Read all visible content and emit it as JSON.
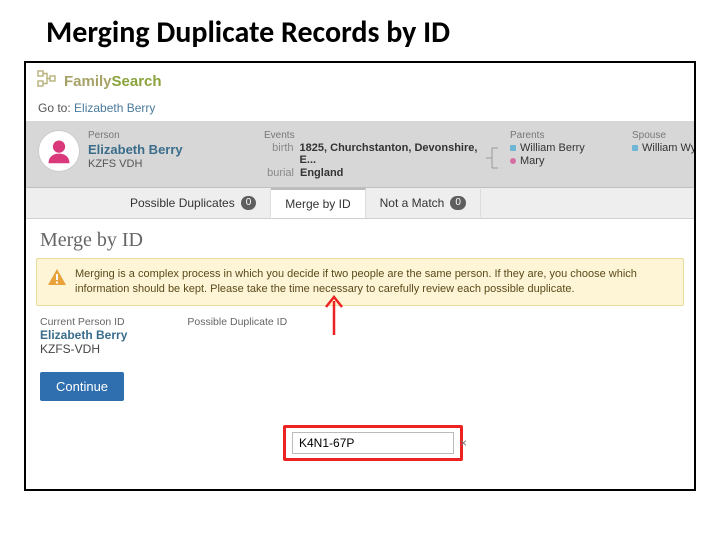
{
  "slide": {
    "title": "Merging Duplicate Records by ID"
  },
  "brand": {
    "part1": "Family",
    "part2": "Search"
  },
  "goto": {
    "label": "Go to: ",
    "link": "Elizabeth Berry"
  },
  "summary": {
    "person_label": "Person",
    "person_name": "Elizabeth Berry",
    "person_id": "KZFS VDH",
    "events_label": "Events",
    "events": [
      {
        "key": "birth",
        "value": "1825, Churchstanton, Devonshire, E..."
      },
      {
        "key": "burial",
        "value": "England"
      }
    ],
    "parents_label": "Parents",
    "parents": [
      {
        "bullet": "b-blue",
        "name": "William Berry"
      },
      {
        "bullet": "b-pink",
        "name": "Mary"
      }
    ],
    "spouse_label": "Spouse",
    "spouse": [
      {
        "bullet": "b-blue",
        "name": "William Wyatt"
      }
    ]
  },
  "tabs": {
    "dup_label": "Possible Duplicates",
    "dup_count": "0",
    "merge_label": "Merge by ID",
    "notmatch_label": "Not a Match",
    "notmatch_count": "0"
  },
  "section": {
    "title": "Merge by ID"
  },
  "warning": {
    "text": "Merging is a complex process in which you decide if two people are the same person. If they are, you choose which information should be kept. Please take the time necessary to carefully review each possible duplicate."
  },
  "idcols": {
    "current_label": "Current Person ID",
    "current_name": "Elizabeth Berry",
    "current_id": "KZFS-VDH",
    "possible_label": "Possible Duplicate ID",
    "input_value": "K4N1-67P"
  },
  "buttons": {
    "continue": "Continue"
  }
}
